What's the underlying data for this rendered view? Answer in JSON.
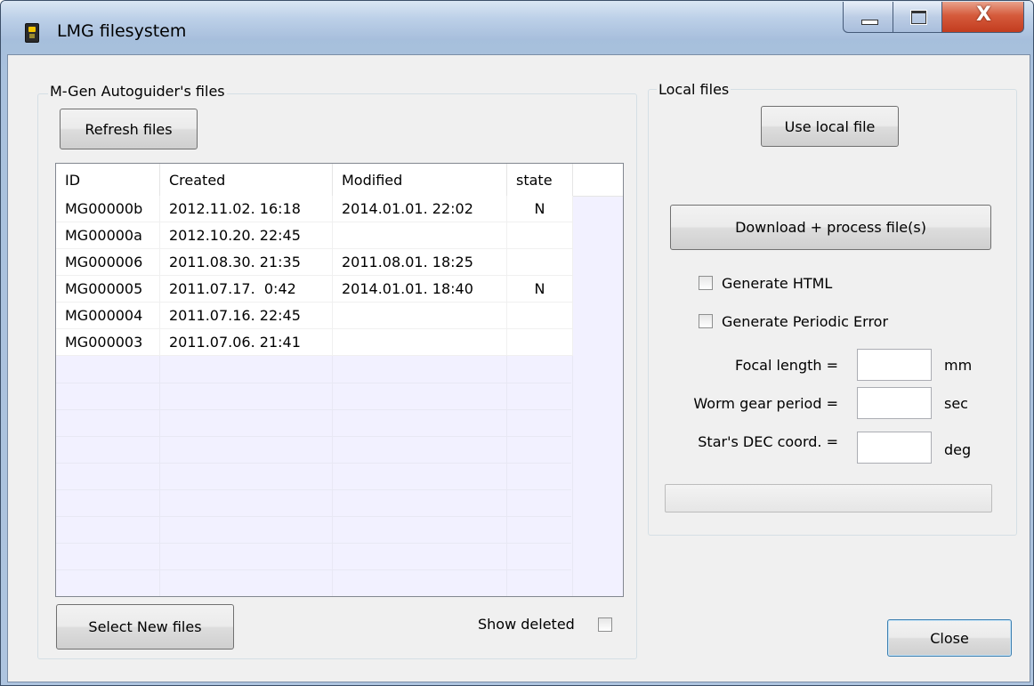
{
  "window": {
    "title": "LMG filesystem",
    "close_glyph": "X"
  },
  "left_group": {
    "legend": "M-Gen Autoguider's files",
    "refresh_label": "Refresh files",
    "columns": [
      "ID",
      "Created",
      "Modified",
      "state"
    ],
    "rows": [
      {
        "id": "MG00000b",
        "created": "2012.11.02. 16:18",
        "modified": "2014.01.01. 22:02",
        "state": "N"
      },
      {
        "id": "MG00000a",
        "created": "2012.10.20. 22:45",
        "modified": "",
        "state": ""
      },
      {
        "id": "MG000006",
        "created": "2011.08.30. 21:35",
        "modified": "2011.08.01. 18:25",
        "state": ""
      },
      {
        "id": "MG000005",
        "created": "2011.07.17.  0:42",
        "modified": "2014.01.01. 18:40",
        "state": "N"
      },
      {
        "id": "MG000004",
        "created": "2011.07.16. 22:45",
        "modified": "",
        "state": ""
      },
      {
        "id": "MG000003",
        "created": "2011.07.06. 21:41",
        "modified": "",
        "state": ""
      }
    ],
    "select_new_label": "Select New files",
    "show_deleted_label": "Show deleted",
    "show_deleted_checked": false
  },
  "right_group": {
    "legend": "Local files",
    "use_local_label": "Use local file",
    "download_label": "Download + process file(s)",
    "generate_html_label": "Generate HTML",
    "generate_html_checked": false,
    "generate_pe_label": "Generate Periodic Error",
    "generate_pe_checked": false,
    "focal_length_label": "Focal length =",
    "focal_length_value": "",
    "focal_length_unit": "mm",
    "worm_period_label": "Worm gear period =",
    "worm_period_value": "",
    "worm_period_unit": "sec",
    "star_dec_label": "Star's DEC coord. =",
    "star_dec_value": "",
    "star_dec_unit": "deg",
    "progress": 0
  },
  "close_label": "Close"
}
